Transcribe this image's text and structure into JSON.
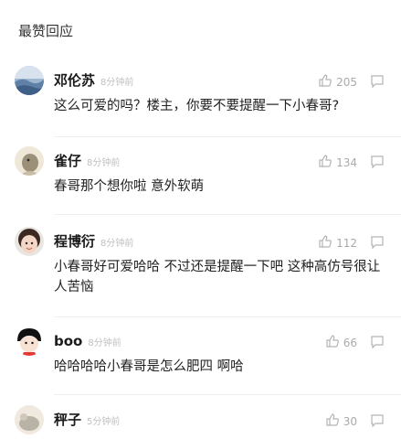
{
  "section": {
    "title": "最赞回应"
  },
  "comments": [
    {
      "name": "邓伦苏",
      "time": "8分钟前",
      "likes": "205",
      "text": "这么可爱的吗？楼主，你要不要提醒一下小春哥?",
      "avatar_colors": [
        "#6e8fb5",
        "#cfd9e6"
      ]
    },
    {
      "name": "雀仔",
      "time": "8分钟前",
      "likes": "134",
      "text": "春哥那个想你啦 意外软萌",
      "avatar_colors": [
        "#8a7f6a",
        "#d9cfba"
      ]
    },
    {
      "name": "程博衍",
      "time": "8分钟前",
      "likes": "112",
      "text": "小春哥好可爱哈哈 不过还是提醒一下吧 这种高仿号很让人苦恼",
      "avatar_colors": [
        "#3a2a22",
        "#f2d3c2"
      ]
    },
    {
      "name": "boo",
      "time": "8分钟前",
      "likes": "66",
      "text": "哈哈哈哈小春哥是怎么肥四 啊哈",
      "avatar_colors": [
        "#1a1a1a",
        "#e53935"
      ]
    },
    {
      "name": "秤子",
      "time": "5分钟前",
      "likes": "30",
      "text": "",
      "avatar_colors": [
        "#b9b2a6",
        "#efe9df"
      ]
    }
  ],
  "icons": {
    "like": "thumbs-up-icon",
    "reply": "comment-bubble-icon"
  }
}
